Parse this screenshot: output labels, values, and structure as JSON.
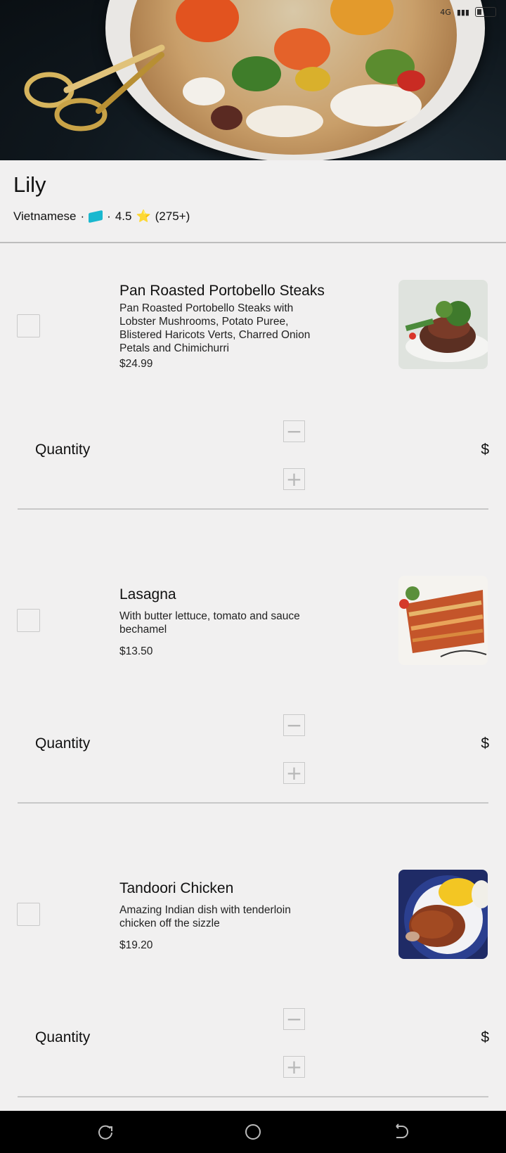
{
  "status_bar": {
    "network": "4G"
  },
  "restaurant": {
    "name": "Lily",
    "cuisine": "Vietnamese",
    "separator": "·",
    "rating": "4.5",
    "rating_icon": "⭐",
    "reviews": "(275+)"
  },
  "items": [
    {
      "title": "Pan Roasted Portobello Steaks",
      "description": "Pan Roasted Portobello Steaks with Lobster Mushrooms, Potato Puree, Blistered Haricots Verts, Charred Onion Petals and Chimichurri",
      "price": "$24.99",
      "quantity_label": "Quantity",
      "currency": "$",
      "minus": "−",
      "plus": "+"
    },
    {
      "title": "Lasagna",
      "description": "With butter lettuce, tomato and sauce bechamel",
      "price": "$13.50",
      "quantity_label": "Quantity",
      "currency": "$",
      "minus": "−",
      "plus": "+"
    },
    {
      "title": "Tandoori Chicken",
      "description": "Amazing Indian dish with tenderloin chicken off the sizzle",
      "price": "$19.20",
      "quantity_label": "Quantity",
      "currency": "$",
      "minus": "−",
      "plus": "+"
    }
  ],
  "icons": {
    "cuisine": "cuisine-tag-icon",
    "rating": "star-icon",
    "nav_recent": "recent-apps-icon",
    "nav_home": "home-icon",
    "nav_back": "back-icon"
  },
  "colors": {
    "accent_tag": "#1ab8cf",
    "background": "#f1f0f0",
    "navbar": "#000000"
  }
}
